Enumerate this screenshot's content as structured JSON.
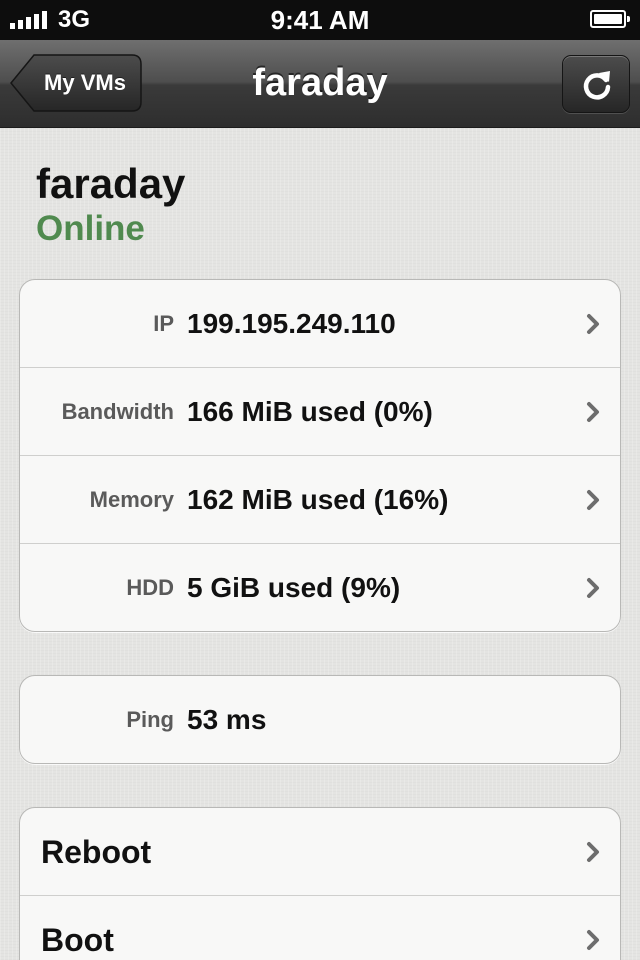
{
  "status_bar": {
    "carrier": "3G",
    "time": "9:41 AM",
    "signal_bars": 5,
    "battery_level": 1.0,
    "icons": [
      "signal-icon",
      "battery-icon"
    ]
  },
  "nav": {
    "back_label": "My VMs",
    "title": "faraday",
    "refresh_icon": "refresh-icon"
  },
  "vm": {
    "name": "faraday",
    "status": "Online",
    "status_color": "#508a4f"
  },
  "details": {
    "rows": [
      {
        "label": "IP",
        "value": "199.195.249.110"
      },
      {
        "label": "Bandwidth",
        "value": "166 MiB used (0%)"
      },
      {
        "label": "Memory",
        "value": "162 MiB used (16%)"
      },
      {
        "label": "HDD",
        "value": "5 GiB used (9%)"
      }
    ]
  },
  "ping": {
    "label": "Ping",
    "value": "53 ms"
  },
  "actions": {
    "items": [
      {
        "label": "Reboot"
      },
      {
        "label": "Boot"
      }
    ]
  },
  "colors": {
    "background": "#e4e4e2",
    "nav_bar": "#3a3a3a",
    "status_online": "#508a4f",
    "chevron": "#6d6d6d"
  }
}
